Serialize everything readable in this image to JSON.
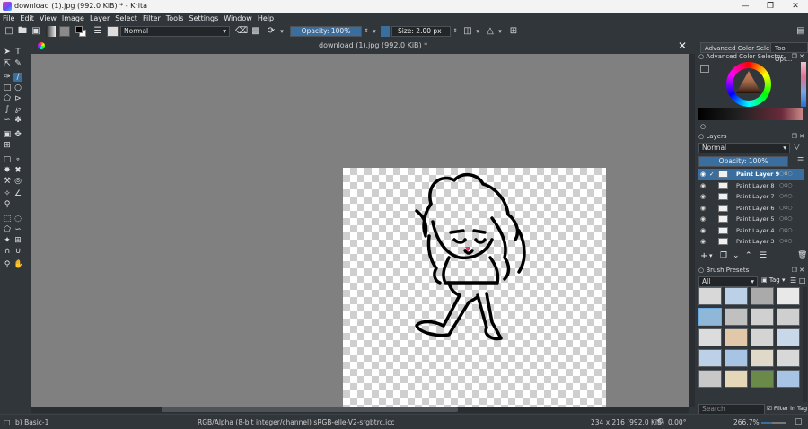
{
  "window": {
    "title": "download (1).jpg (992.0 KiB) * - Krita",
    "min_icon": "minimize-icon",
    "max_icon": "maximize-icon",
    "close_icon": "close-icon"
  },
  "menu": [
    "File",
    "Edit",
    "View",
    "Image",
    "Layer",
    "Select",
    "Filter",
    "Tools",
    "Settings",
    "Window",
    "Help"
  ],
  "toolbar": {
    "blend_mode": "Normal",
    "opacity_label": "Opacity: 100%",
    "opacity_value": 1.0,
    "size_label": "Size: 2.00 px"
  },
  "document": {
    "tab_title": "download (1).jpg (992.0 KiB) *"
  },
  "dock": {
    "tabs": [
      "Advanced Color Sele...",
      "Tool Opt..."
    ],
    "color_selector_title": "Advanced Color Selector",
    "layers_title": "Layers",
    "layers_blend": "Normal",
    "layers_opacity": "Opacity:  100%",
    "layers": [
      {
        "name": "Paint Layer 9",
        "selected": true
      },
      {
        "name": "Paint Layer 8",
        "selected": false
      },
      {
        "name": "Paint Layer 7",
        "selected": false
      },
      {
        "name": "Paint Layer 6",
        "selected": false
      },
      {
        "name": "Paint Layer 5",
        "selected": false
      },
      {
        "name": "Paint Layer 4",
        "selected": false
      },
      {
        "name": "Paint Layer 3",
        "selected": false
      }
    ],
    "brush_presets_title": "Brush Presets",
    "brush_filter": "All",
    "brush_tag": "Tag",
    "search_placeholder": "Search",
    "filter_in_tag": "Filter in Tag"
  },
  "status": {
    "preset": "b) Basic-1",
    "color_space": "RGB/Alpha (8-bit integer/channel)  sRGB-elle-V2-srgbtrc.icc",
    "dimensions": "234 x 216 (992.0 KiB)",
    "rotation": "0.00°",
    "zoom": "266.7%"
  },
  "colors": {
    "accent": "#3a6e9e",
    "panel": "#31363b",
    "canvas_bg": "#808080"
  }
}
